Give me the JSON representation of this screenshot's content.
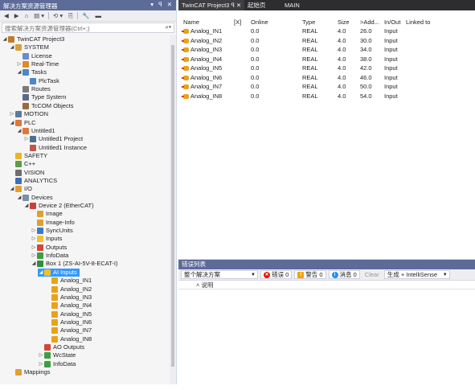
{
  "solution_explorer": {
    "title": "解决方案资源管理器",
    "window_controls": "▾ ꟼ ✕",
    "toolbar": [
      "◀",
      "▶",
      "⌂",
      "▤ ▾",
      "⟲ ▾",
      "⎘",
      "🔧",
      "▬"
    ],
    "search_placeholder": "搜索解决方案资源管理器(Ctrl+;)",
    "tree": [
      {
        "label": "TwinCAT Project3",
        "level": 0,
        "arrow": "◢",
        "icon": "#c27b2a"
      },
      {
        "label": "SYSTEM",
        "level": 1,
        "arrow": "◢",
        "icon": "#d8a03a"
      },
      {
        "label": "License",
        "level": 2,
        "arrow": "",
        "icon": "#6b8cc7"
      },
      {
        "label": "Real-Time",
        "level": 2,
        "arrow": "▷",
        "icon": "#e08a2c"
      },
      {
        "label": "Tasks",
        "level": 2,
        "arrow": "◢",
        "icon": "#4a86c8"
      },
      {
        "label": "PlcTask",
        "level": 3,
        "arrow": "",
        "icon": "#4a86c8"
      },
      {
        "label": "Routes",
        "level": 2,
        "arrow": "",
        "icon": "#7b7b7b"
      },
      {
        "label": "Type System",
        "level": 2,
        "arrow": "",
        "icon": "#5a6a86"
      },
      {
        "label": "TcCOM Objects",
        "level": 2,
        "arrow": "",
        "icon": "#9a6a3c"
      },
      {
        "label": "MOTION",
        "level": 1,
        "arrow": "▷",
        "icon": "#5c7b9c"
      },
      {
        "label": "PLC",
        "level": 1,
        "arrow": "◢",
        "icon": "#e2763a"
      },
      {
        "label": "Untitled1",
        "level": 2,
        "arrow": "◢",
        "icon": "#e2763a"
      },
      {
        "label": "Untitled1 Project",
        "level": 3,
        "arrow": "▷",
        "icon": "#4c6f8f"
      },
      {
        "label": "Untitled1 Instance",
        "level": 3,
        "arrow": "",
        "icon": "#c6524a"
      },
      {
        "label": "SAFETY",
        "level": 1,
        "arrow": "",
        "icon": "#e8b628"
      },
      {
        "label": "C++",
        "level": 1,
        "arrow": "",
        "icon": "#5a9c4a"
      },
      {
        "label": "VISION",
        "level": 1,
        "arrow": "",
        "icon": "#6d6d6d"
      },
      {
        "label": "ANALYTICS",
        "level": 1,
        "arrow": "",
        "icon": "#3e6fb0"
      },
      {
        "label": "I/O",
        "level": 1,
        "arrow": "◢",
        "icon": "#e0a030"
      },
      {
        "label": "Devices",
        "level": 2,
        "arrow": "◢",
        "icon": "#7c8fa8"
      },
      {
        "label": "Device 2 (EtherCAT)",
        "level": 3,
        "arrow": "◢",
        "icon": "#c9403a"
      },
      {
        "label": "Image",
        "level": 4,
        "arrow": "",
        "icon": "#e0a030"
      },
      {
        "label": "Image-Info",
        "level": 4,
        "arrow": "",
        "icon": "#e0a030"
      },
      {
        "label": "SyncUnits",
        "level": 4,
        "arrow": "▷",
        "icon": "#3a7ac8"
      },
      {
        "label": "Inputs",
        "level": 4,
        "arrow": "▷",
        "icon": "#f0c030"
      },
      {
        "label": "Outputs",
        "level": 4,
        "arrow": "▷",
        "icon": "#d8443a"
      },
      {
        "label": "InfoData",
        "level": 4,
        "arrow": "▷",
        "icon": "#3aa040"
      },
      {
        "label": "Box 1 (ZS-AI-5V-8-ECAT-I)",
        "level": 4,
        "arrow": "◢",
        "icon": "#2f8f3a"
      },
      {
        "label": "AI Inputs",
        "level": 5,
        "arrow": "◢",
        "icon": "#f0c030",
        "selected": true
      },
      {
        "label": "Analog_IN1",
        "level": 6,
        "arrow": "",
        "icon": "#e8a317"
      },
      {
        "label": "Analog_IN2",
        "level": 6,
        "arrow": "",
        "icon": "#e8a317"
      },
      {
        "label": "Analog_IN3",
        "level": 6,
        "arrow": "",
        "icon": "#e8a317"
      },
      {
        "label": "Analog_IN4",
        "level": 6,
        "arrow": "",
        "icon": "#e8a317"
      },
      {
        "label": "Analog_IN5",
        "level": 6,
        "arrow": "",
        "icon": "#e8a317"
      },
      {
        "label": "Analog_IN6",
        "level": 6,
        "arrow": "",
        "icon": "#e8a317"
      },
      {
        "label": "Analog_IN7",
        "level": 6,
        "arrow": "",
        "icon": "#e8a317"
      },
      {
        "label": "Analog_IN8",
        "level": 6,
        "arrow": "",
        "icon": "#e8a317"
      },
      {
        "label": "AO Outputs",
        "level": 5,
        "arrow": "",
        "icon": "#d8443a"
      },
      {
        "label": "WcState",
        "level": 5,
        "arrow": "▷",
        "icon": "#3aa040"
      },
      {
        "label": "InfoData",
        "level": 5,
        "arrow": "▷",
        "icon": "#3aa040"
      },
      {
        "label": "Mappings",
        "level": 1,
        "arrow": "",
        "icon": "#e0a030"
      }
    ]
  },
  "tabs": [
    {
      "label": "TwinCAT Project3",
      "active": true
    },
    {
      "label": "ꟼ ✕",
      "active": true
    },
    {
      "label": "起始页",
      "active": false
    },
    {
      "label": "MAIN",
      "active": false
    }
  ],
  "variable_table": {
    "columns": [
      "Name",
      "[X]",
      "Online",
      "Type",
      "Size",
      ">Add...",
      "In/Out",
      "Linked to"
    ],
    "rows": [
      [
        "Analog_IN1",
        "",
        "0.0",
        "REAL",
        "4.0",
        "26.0",
        "Input",
        ""
      ],
      [
        "Analog_IN2",
        "",
        "0.0",
        "REAL",
        "4.0",
        "30.0",
        "Input",
        ""
      ],
      [
        "Analog_IN3",
        "",
        "0.0",
        "REAL",
        "4.0",
        "34.0",
        "Input",
        ""
      ],
      [
        "Analog_IN4",
        "",
        "0.0",
        "REAL",
        "4.0",
        "38.0",
        "Input",
        ""
      ],
      [
        "Analog_IN5",
        "",
        "0.0",
        "REAL",
        "4.0",
        "42.0",
        "Input",
        ""
      ],
      [
        "Analog_IN6",
        "",
        "0.0",
        "REAL",
        "4.0",
        "46.0",
        "Input",
        ""
      ],
      [
        "Analog_IN7",
        "",
        "0.0",
        "REAL",
        "4.0",
        "50.0",
        "Input",
        ""
      ],
      [
        "Analog_IN8",
        "",
        "0.0",
        "REAL",
        "4.0",
        "54.0",
        "Input",
        ""
      ]
    ]
  },
  "error_list": {
    "title": "错误列表",
    "scope_selected": "整个解决方案",
    "errors_label": "错误 0",
    "warnings_label": "警告 0",
    "messages_label": "消息 0",
    "clear_label": "Clear",
    "build_selected": "生成 + IntelliSense",
    "column_description": "说明",
    "colors": {
      "error": "#e51400",
      "warning": "#f0a30a",
      "message": "#1e90ff"
    }
  },
  "colors": {
    "accent": "#3399ff",
    "title_bar": "#5d6b99",
    "tab_bar": "#2d2d30"
  }
}
